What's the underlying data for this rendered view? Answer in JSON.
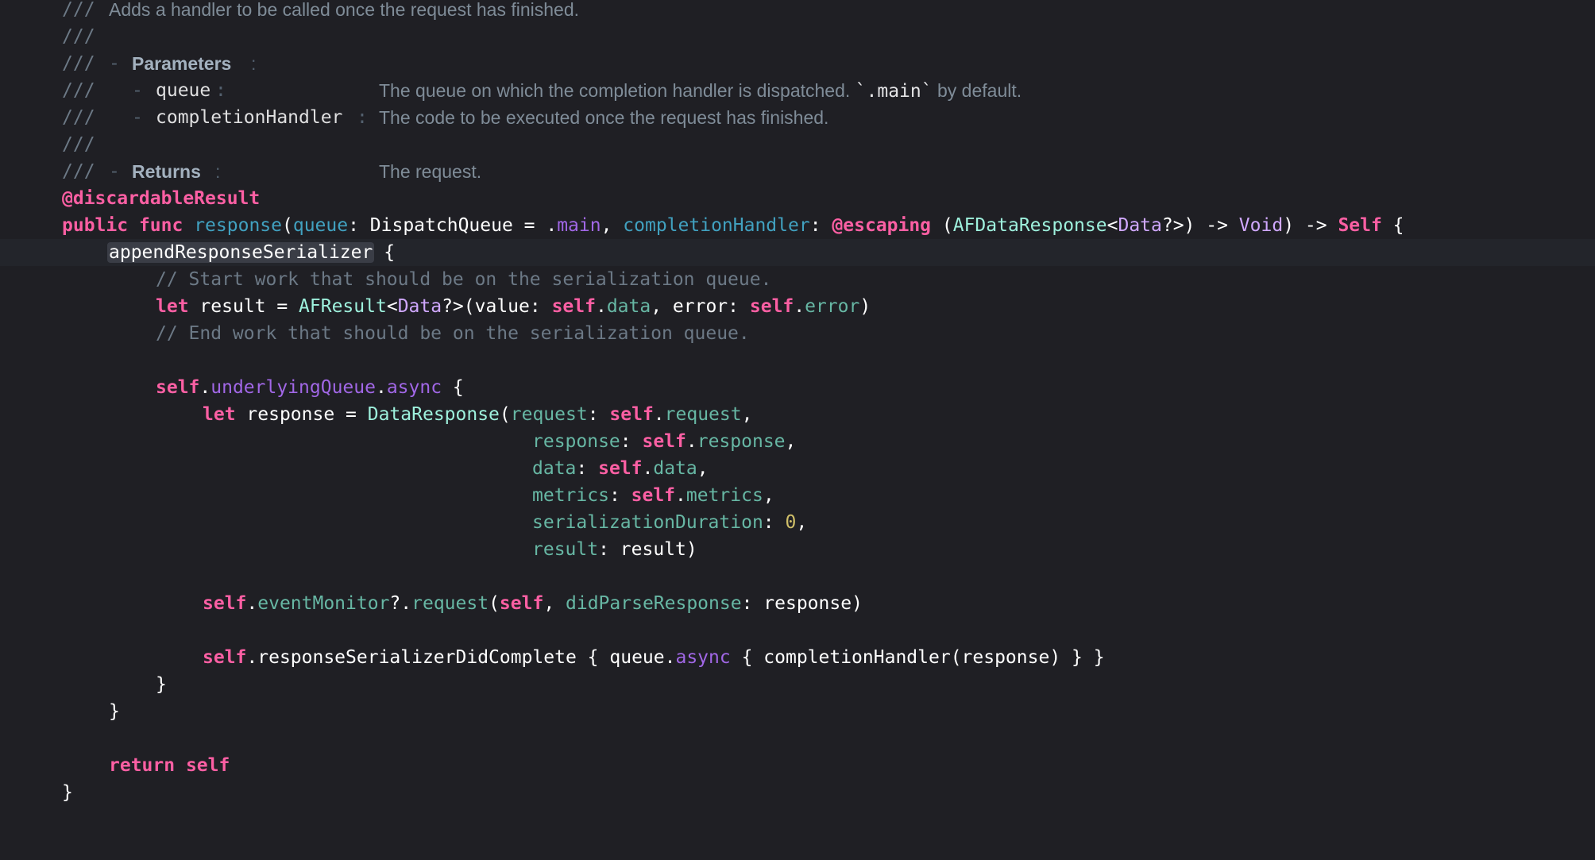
{
  "doc": {
    "slashes": "///",
    "summary": "Adds a handler to be called once the request has finished.",
    "parameters_label": "Parameters",
    "params": [
      {
        "name": "queue",
        "desc_pre": "The queue on which the completion handler is dispatched. ",
        "desc_code": "`.main`",
        "desc_post": " by default."
      },
      {
        "name": "completionHandler",
        "desc": "The code to be executed once the request has finished."
      }
    ],
    "returns_label": "Returns",
    "returns_desc": "The request."
  },
  "code": {
    "attribute": "@discardableResult",
    "kw_public": "public",
    "kw_func": "func",
    "func_name": "response",
    "param_queue": "queue",
    "type_dispatchqueue": "DispatchQueue",
    "member_main": "main",
    "param_completion": "completionHandler",
    "attr_escaping": "@escaping",
    "type_afdataresponse": "AFDataResponse",
    "type_data": "Data",
    "type_void": "Void",
    "kw_self_type": "Self",
    "call_append": "appendResponseSerializer",
    "comment_start": "// Start work that should be on the serialization queue.",
    "kw_let": "let",
    "var_result": "result",
    "type_afresult": "AFResult",
    "label_value": "value",
    "kw_self": "self",
    "member_data": "data",
    "label_error": "error",
    "member_error": "error",
    "comment_end": "// End work that should be on the serialization queue.",
    "member_underlying": "underlyingQueue",
    "member_async": "async",
    "var_response": "response",
    "type_dataresponse": "DataResponse",
    "label_request": "request",
    "member_request": "request",
    "label_response": "response",
    "member_response": "response",
    "label_data": "data",
    "label_metrics": "metrics",
    "member_metrics": "metrics",
    "label_serialization": "serializationDuration",
    "num_zero": "0",
    "label_result": "result",
    "member_eventmonitor": "eventMonitor",
    "member_request_call": "request",
    "label_didparse": "didParseResponse",
    "call_didcomplete": "responseSerializerDidComplete",
    "var_queue": "queue",
    "call_completion": "completionHandler",
    "kw_return": "return"
  }
}
